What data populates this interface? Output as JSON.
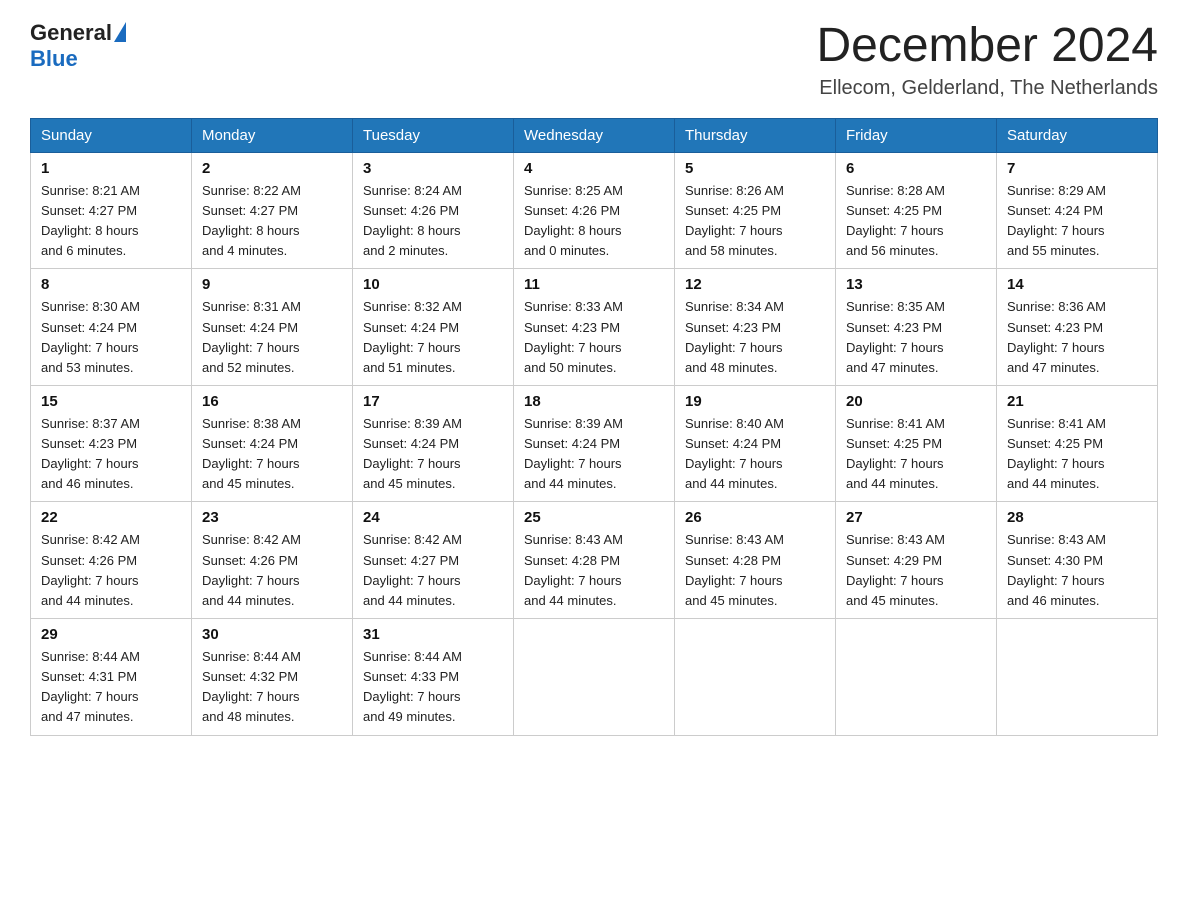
{
  "header": {
    "logo_general": "General",
    "logo_blue": "Blue",
    "month_title": "December 2024",
    "location": "Ellecom, Gelderland, The Netherlands"
  },
  "weekdays": [
    "Sunday",
    "Monday",
    "Tuesday",
    "Wednesday",
    "Thursday",
    "Friday",
    "Saturday"
  ],
  "weeks": [
    [
      {
        "day": "1",
        "lines": [
          "Sunrise: 8:21 AM",
          "Sunset: 4:27 PM",
          "Daylight: 8 hours",
          "and 6 minutes."
        ]
      },
      {
        "day": "2",
        "lines": [
          "Sunrise: 8:22 AM",
          "Sunset: 4:27 PM",
          "Daylight: 8 hours",
          "and 4 minutes."
        ]
      },
      {
        "day": "3",
        "lines": [
          "Sunrise: 8:24 AM",
          "Sunset: 4:26 PM",
          "Daylight: 8 hours",
          "and 2 minutes."
        ]
      },
      {
        "day": "4",
        "lines": [
          "Sunrise: 8:25 AM",
          "Sunset: 4:26 PM",
          "Daylight: 8 hours",
          "and 0 minutes."
        ]
      },
      {
        "day": "5",
        "lines": [
          "Sunrise: 8:26 AM",
          "Sunset: 4:25 PM",
          "Daylight: 7 hours",
          "and 58 minutes."
        ]
      },
      {
        "day": "6",
        "lines": [
          "Sunrise: 8:28 AM",
          "Sunset: 4:25 PM",
          "Daylight: 7 hours",
          "and 56 minutes."
        ]
      },
      {
        "day": "7",
        "lines": [
          "Sunrise: 8:29 AM",
          "Sunset: 4:24 PM",
          "Daylight: 7 hours",
          "and 55 minutes."
        ]
      }
    ],
    [
      {
        "day": "8",
        "lines": [
          "Sunrise: 8:30 AM",
          "Sunset: 4:24 PM",
          "Daylight: 7 hours",
          "and 53 minutes."
        ]
      },
      {
        "day": "9",
        "lines": [
          "Sunrise: 8:31 AM",
          "Sunset: 4:24 PM",
          "Daylight: 7 hours",
          "and 52 minutes."
        ]
      },
      {
        "day": "10",
        "lines": [
          "Sunrise: 8:32 AM",
          "Sunset: 4:24 PM",
          "Daylight: 7 hours",
          "and 51 minutes."
        ]
      },
      {
        "day": "11",
        "lines": [
          "Sunrise: 8:33 AM",
          "Sunset: 4:23 PM",
          "Daylight: 7 hours",
          "and 50 minutes."
        ]
      },
      {
        "day": "12",
        "lines": [
          "Sunrise: 8:34 AM",
          "Sunset: 4:23 PM",
          "Daylight: 7 hours",
          "and 48 minutes."
        ]
      },
      {
        "day": "13",
        "lines": [
          "Sunrise: 8:35 AM",
          "Sunset: 4:23 PM",
          "Daylight: 7 hours",
          "and 47 minutes."
        ]
      },
      {
        "day": "14",
        "lines": [
          "Sunrise: 8:36 AM",
          "Sunset: 4:23 PM",
          "Daylight: 7 hours",
          "and 47 minutes."
        ]
      }
    ],
    [
      {
        "day": "15",
        "lines": [
          "Sunrise: 8:37 AM",
          "Sunset: 4:23 PM",
          "Daylight: 7 hours",
          "and 46 minutes."
        ]
      },
      {
        "day": "16",
        "lines": [
          "Sunrise: 8:38 AM",
          "Sunset: 4:24 PM",
          "Daylight: 7 hours",
          "and 45 minutes."
        ]
      },
      {
        "day": "17",
        "lines": [
          "Sunrise: 8:39 AM",
          "Sunset: 4:24 PM",
          "Daylight: 7 hours",
          "and 45 minutes."
        ]
      },
      {
        "day": "18",
        "lines": [
          "Sunrise: 8:39 AM",
          "Sunset: 4:24 PM",
          "Daylight: 7 hours",
          "and 44 minutes."
        ]
      },
      {
        "day": "19",
        "lines": [
          "Sunrise: 8:40 AM",
          "Sunset: 4:24 PM",
          "Daylight: 7 hours",
          "and 44 minutes."
        ]
      },
      {
        "day": "20",
        "lines": [
          "Sunrise: 8:41 AM",
          "Sunset: 4:25 PM",
          "Daylight: 7 hours",
          "and 44 minutes."
        ]
      },
      {
        "day": "21",
        "lines": [
          "Sunrise: 8:41 AM",
          "Sunset: 4:25 PM",
          "Daylight: 7 hours",
          "and 44 minutes."
        ]
      }
    ],
    [
      {
        "day": "22",
        "lines": [
          "Sunrise: 8:42 AM",
          "Sunset: 4:26 PM",
          "Daylight: 7 hours",
          "and 44 minutes."
        ]
      },
      {
        "day": "23",
        "lines": [
          "Sunrise: 8:42 AM",
          "Sunset: 4:26 PM",
          "Daylight: 7 hours",
          "and 44 minutes."
        ]
      },
      {
        "day": "24",
        "lines": [
          "Sunrise: 8:42 AM",
          "Sunset: 4:27 PM",
          "Daylight: 7 hours",
          "and 44 minutes."
        ]
      },
      {
        "day": "25",
        "lines": [
          "Sunrise: 8:43 AM",
          "Sunset: 4:28 PM",
          "Daylight: 7 hours",
          "and 44 minutes."
        ]
      },
      {
        "day": "26",
        "lines": [
          "Sunrise: 8:43 AM",
          "Sunset: 4:28 PM",
          "Daylight: 7 hours",
          "and 45 minutes."
        ]
      },
      {
        "day": "27",
        "lines": [
          "Sunrise: 8:43 AM",
          "Sunset: 4:29 PM",
          "Daylight: 7 hours",
          "and 45 minutes."
        ]
      },
      {
        "day": "28",
        "lines": [
          "Sunrise: 8:43 AM",
          "Sunset: 4:30 PM",
          "Daylight: 7 hours",
          "and 46 minutes."
        ]
      }
    ],
    [
      {
        "day": "29",
        "lines": [
          "Sunrise: 8:44 AM",
          "Sunset: 4:31 PM",
          "Daylight: 7 hours",
          "and 47 minutes."
        ]
      },
      {
        "day": "30",
        "lines": [
          "Sunrise: 8:44 AM",
          "Sunset: 4:32 PM",
          "Daylight: 7 hours",
          "and 48 minutes."
        ]
      },
      {
        "day": "31",
        "lines": [
          "Sunrise: 8:44 AM",
          "Sunset: 4:33 PM",
          "Daylight: 7 hours",
          "and 49 minutes."
        ]
      },
      null,
      null,
      null,
      null
    ]
  ]
}
